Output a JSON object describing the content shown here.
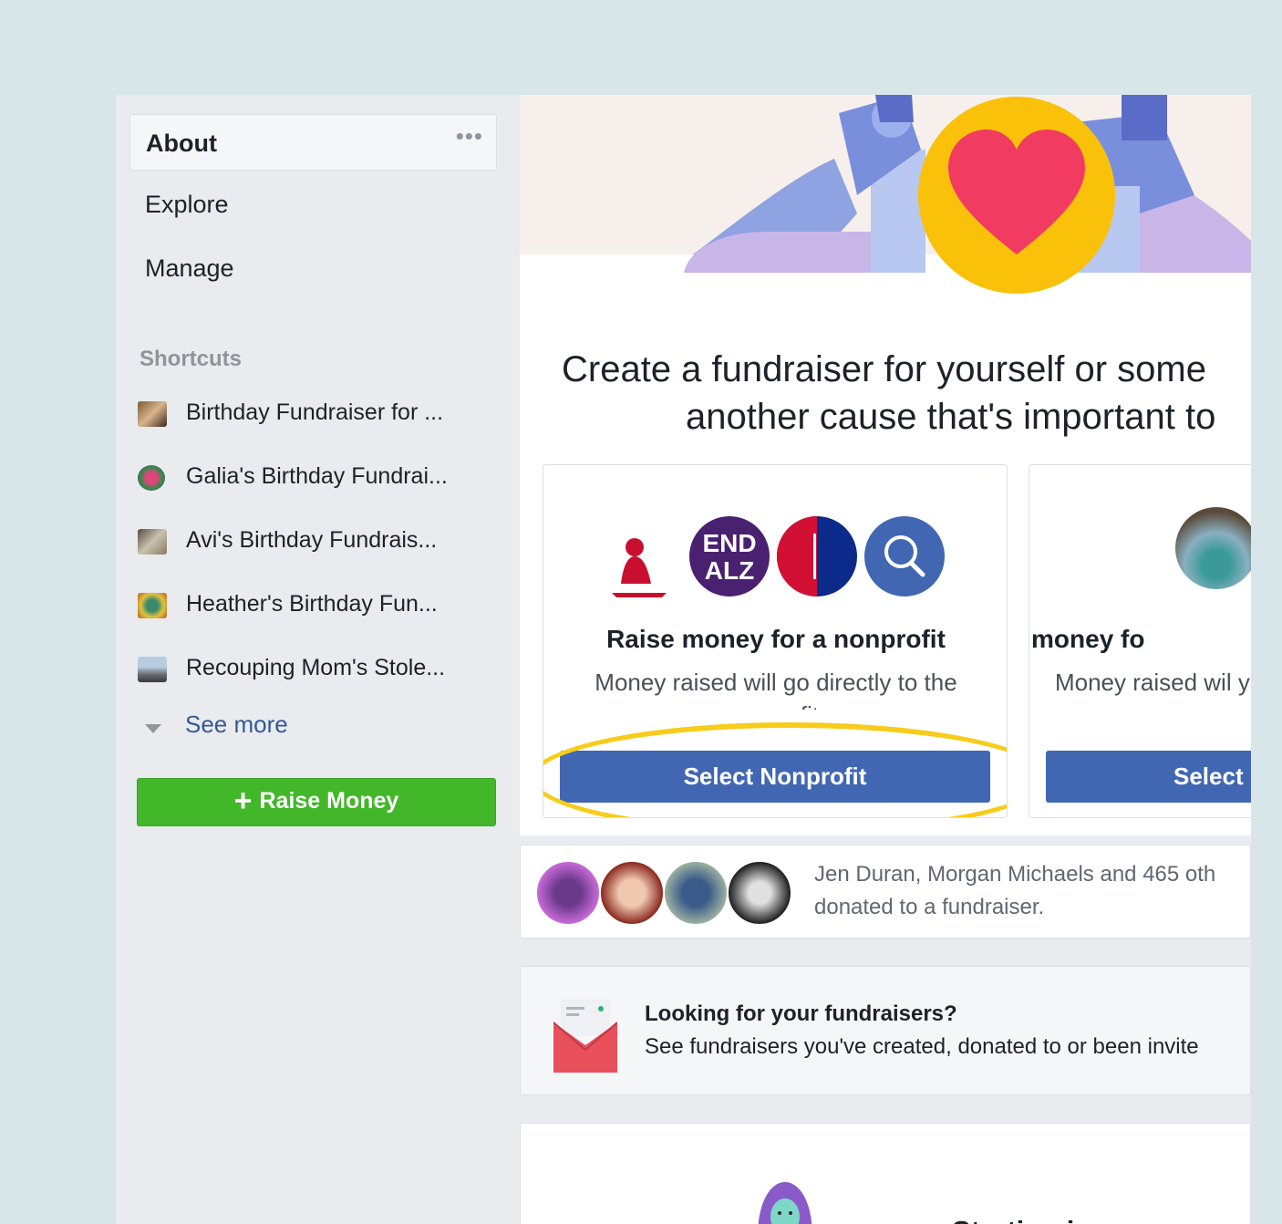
{
  "sidebar": {
    "about": "About",
    "about_more": "•••",
    "explore": "Explore",
    "manage": "Manage",
    "shortcuts_title": "Shortcuts",
    "shortcuts": [
      {
        "label": "Birthday Fundraiser for ..."
      },
      {
        "label": "Galia's Birthday Fundrai..."
      },
      {
        "label": "Avi's Birthday Fundrais..."
      },
      {
        "label": "Heather's Birthday Fun..."
      },
      {
        "label": "Recouping Mom's Stole..."
      }
    ],
    "see_more": "See more",
    "raise_money": "Raise Money"
  },
  "main": {
    "headline_line1": "Create a fundraiser for yourself or some",
    "headline_line2": "another cause that's important to",
    "options": [
      {
        "title": "Raise money for a nonprofit",
        "desc": "Money raised will go directly to the nonprofit.",
        "button": "Select Nonprofit",
        "logo_text": "END ALZ"
      },
      {
        "title": "Raise money fo",
        "desc": "Money raised wil your ban",
        "button": "Select"
      }
    ],
    "donors_line1": "Jen Duran, Morgan Michaels and 465 oth",
    "donors_line2": "donated to a fundraiser.",
    "lookfor_title": "Looking for your fundraisers?",
    "lookfor_desc": "See fundraisers you've created, donated to or been invite",
    "starting_title": "Starting is easy"
  },
  "colors": {
    "primary_button": "#4267b2",
    "raise_button": "#42b72a",
    "highlight": "#f7cc1a",
    "link": "#365899"
  }
}
